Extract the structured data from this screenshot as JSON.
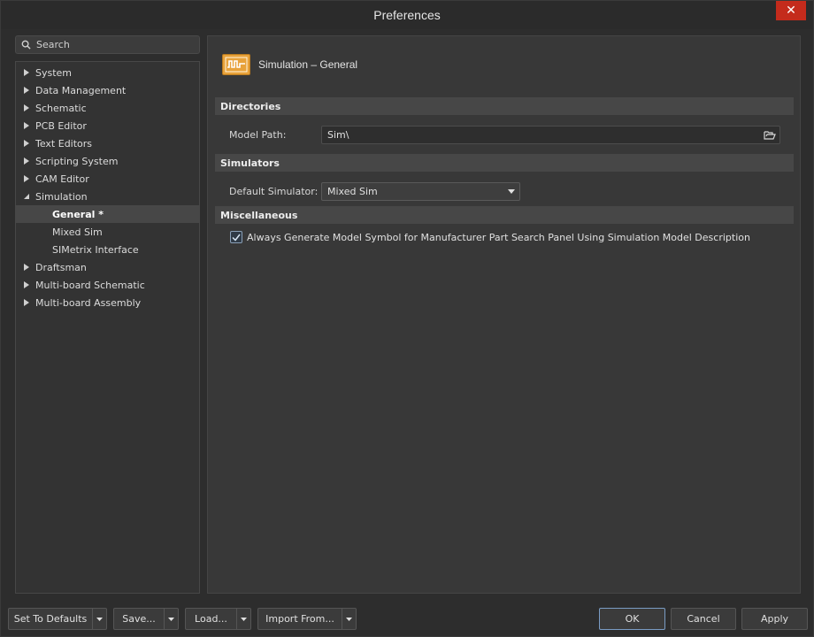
{
  "window": {
    "title": "Preferences",
    "close_glyph": "✕"
  },
  "search": {
    "placeholder": "Search",
    "icon": "search-icon"
  },
  "tree": {
    "items": [
      {
        "label": "System",
        "expanded": false
      },
      {
        "label": "Data Management",
        "expanded": false
      },
      {
        "label": "Schematic",
        "expanded": false
      },
      {
        "label": "PCB Editor",
        "expanded": false
      },
      {
        "label": "Text Editors",
        "expanded": false
      },
      {
        "label": "Scripting System",
        "expanded": false
      },
      {
        "label": "CAM Editor",
        "expanded": false
      },
      {
        "label": "Simulation",
        "expanded": true,
        "children": [
          {
            "label": "General *",
            "selected": true
          },
          {
            "label": "Mixed Sim",
            "selected": false
          },
          {
            "label": "SIMetrix Interface",
            "selected": false
          }
        ]
      },
      {
        "label": "Draftsman",
        "expanded": false
      },
      {
        "label": "Multi-board Schematic",
        "expanded": false
      },
      {
        "label": "Multi-board Assembly",
        "expanded": false
      }
    ]
  },
  "page": {
    "title": "Simulation – General",
    "icon": "simulation-waveform-icon",
    "sections": {
      "directories": "Directories",
      "simulators": "Simulators",
      "miscellaneous": "Miscellaneous"
    },
    "model_path": {
      "label": "Model Path:",
      "value": "Sim\\"
    },
    "default_simulator": {
      "label": "Default Simulator:",
      "value": "Mixed Sim"
    },
    "always_generate": {
      "label": "Always Generate Model Symbol for Manufacturer Part Search Panel Using Simulation Model Description",
      "checked": true
    }
  },
  "buttons": {
    "set_to_defaults": "Set To Defaults",
    "save": "Save...",
    "load": "Load...",
    "import_from": "Import From...",
    "ok": "OK",
    "cancel": "Cancel",
    "apply": "Apply"
  },
  "colors": {
    "accent_icon": "#e8a23a",
    "close_button": "#c42b1c",
    "background": "#2d2d2d"
  }
}
